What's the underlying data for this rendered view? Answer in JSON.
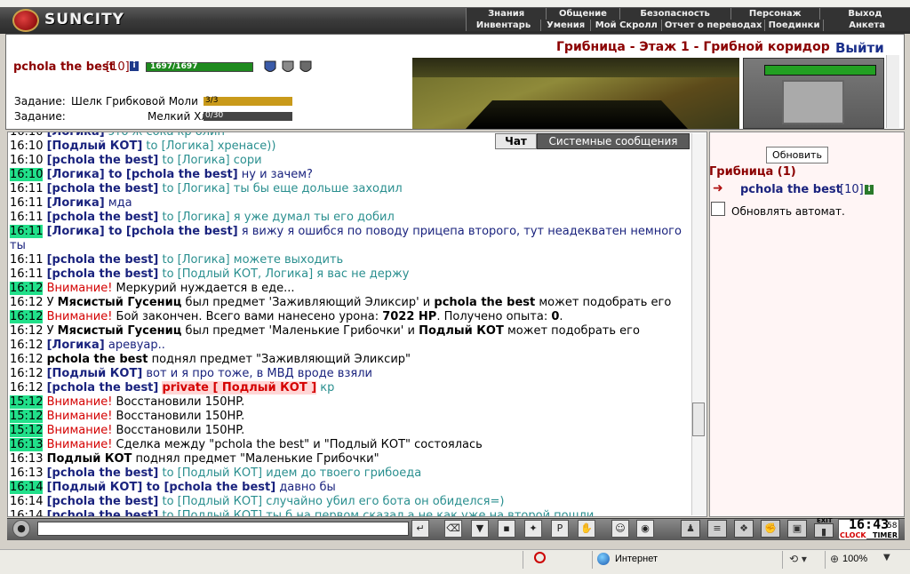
{
  "app": {
    "logo_text": "SUNCITY"
  },
  "menu": {
    "row1": [
      "Знания",
      "Общение",
      "Безопасность",
      "Персонаж",
      "Выход"
    ],
    "row2": [
      "Инвентарь",
      "Умения",
      "Мой Скролл",
      "Отчет о переводах",
      "Поединки",
      "Анкета"
    ]
  },
  "header": {
    "char_name": "pchola the best",
    "char_level": "[10]",
    "hp": "1697/1697",
    "hp_fraction": 1.0,
    "location": "Грибница - Этаж 1 - Грибной коридор",
    "exit_label": "Выйти",
    "quests": [
      {
        "label": "Задание:",
        "name": "Шелк Грибковой Моли",
        "progress": "3/3",
        "fraction": 1.0
      },
      {
        "label": "Задание:",
        "name": "Мелкий Хлюп",
        "progress": "0/30",
        "fraction": 0.0
      }
    ]
  },
  "chat": {
    "tabs": [
      "Чат",
      "Системные сообщения"
    ],
    "lines": [
      [
        "16:10 ",
        "t"
      ],
      [
        "16:10 ",
        "t"
      ],
      [
        "16:10 ",
        "t"
      ],
      [
        "16:10 ",
        "t"
      ]
    ],
    "messages": [
      {
        "time": "16:10",
        "hl": false,
        "segments": [
          [
            "[Логика]",
            "n"
          ],
          [
            " это ж сока кр олин",
            "msg"
          ]
        ]
      },
      {
        "time": "16:10",
        "hl": false,
        "segments": [
          [
            "[Подлый КОТ]",
            "n"
          ],
          [
            " to [Логика]",
            "to"
          ],
          [
            " хренасе))",
            "msg"
          ]
        ]
      },
      {
        "time": "16:10",
        "hl": false,
        "segments": [
          [
            "[pchola the best]",
            "n"
          ],
          [
            " to [Логика]",
            "to"
          ],
          [
            " сори",
            "msg"
          ]
        ]
      },
      {
        "time": "16:10",
        "hl": true,
        "segments": [
          [
            "[Логика]",
            "n"
          ],
          [
            " to [pchola the best]",
            "n"
          ],
          [
            " ну и зачем?",
            "msgp"
          ]
        ]
      },
      {
        "time": "16:11",
        "hl": false,
        "segments": [
          [
            "[pchola the best]",
            "n"
          ],
          [
            " to [Логика]",
            "to"
          ],
          [
            " ты бы еще дольше заходил",
            "msg"
          ]
        ]
      },
      {
        "time": "16:11",
        "hl": false,
        "segments": [
          [
            "[Логика]",
            "n"
          ],
          [
            " мда",
            "msgp"
          ]
        ]
      },
      {
        "time": "16:11",
        "hl": false,
        "segments": [
          [
            "[pchola the best]",
            "n"
          ],
          [
            " to [Логика]",
            "to"
          ],
          [
            " я уже думал ты его добил",
            "msg"
          ]
        ]
      },
      {
        "time": "16:11",
        "hl": true,
        "segments": [
          [
            "[Логика]",
            "n"
          ],
          [
            " to [pchola the best]",
            "n"
          ],
          [
            " я вижу я ошибся по поводу прицепа второго, тут неадекватен немного",
            "msgp"
          ]
        ]
      },
      {
        "time": "",
        "hl": false,
        "segments": [
          [
            "ты",
            "msgp"
          ]
        ]
      },
      {
        "time": "16:11",
        "hl": false,
        "segments": [
          [
            "[pchola the best]",
            "n"
          ],
          [
            " to [Логика]",
            "to"
          ],
          [
            " можете выходить",
            "msg"
          ]
        ]
      },
      {
        "time": "16:11",
        "hl": false,
        "segments": [
          [
            "[pchola the best]",
            "n"
          ],
          [
            " to [Подлый КОТ, Логика]",
            "to"
          ],
          [
            " я вас не держу",
            "msg"
          ]
        ]
      },
      {
        "time": "16:12",
        "hl": true,
        "segments": [
          [
            "Внимание!",
            "warn"
          ],
          [
            " Меркурий нуждается в еде...",
            "sys"
          ]
        ]
      },
      {
        "time": "16:12",
        "hl": false,
        "segments": [
          [
            "У ",
            "sys"
          ],
          [
            "Мясистый Гусениц",
            "b"
          ],
          [
            " был предмет 'Заживляющий Эликсир' и ",
            "sys"
          ],
          [
            "pchola the best",
            "b"
          ],
          [
            " может подобрать его",
            "sys"
          ]
        ]
      },
      {
        "time": "16:12",
        "hl": true,
        "segments": [
          [
            "Внимание!",
            "warn"
          ],
          [
            " Бой закончен. Всего вами нанесено урона: ",
            "sys"
          ],
          [
            "7022 HP",
            "b"
          ],
          [
            ". Получено опыта: ",
            "sys"
          ],
          [
            "0",
            "b"
          ],
          [
            ".",
            "sys"
          ]
        ]
      },
      {
        "time": "16:12",
        "hl": false,
        "segments": [
          [
            "У ",
            "sys"
          ],
          [
            "Мясистый Гусениц",
            "b"
          ],
          [
            " был предмет 'Маленькие Грибочки' и ",
            "sys"
          ],
          [
            "Подлый КОТ",
            "b"
          ],
          [
            " может подобрать его",
            "sys"
          ]
        ]
      },
      {
        "time": "16:12",
        "hl": false,
        "segments": [
          [
            "[Логика]",
            "n"
          ],
          [
            " аревуар..",
            "msgp"
          ]
        ]
      },
      {
        "time": "16:12",
        "hl": false,
        "segments": [
          [
            "pchola the best",
            "b"
          ],
          [
            " поднял предмет \"Заживляющий Эликсир\"",
            "sys"
          ]
        ]
      },
      {
        "time": "16:12",
        "hl": false,
        "segments": [
          [
            "[Подлый КОТ]",
            "n"
          ],
          [
            " вот и я про тоже, в МВД вроде взяли",
            "msgp"
          ]
        ]
      },
      {
        "time": "16:12",
        "hl": false,
        "segments": [
          [
            "[pchola the best]",
            "n"
          ],
          [
            " ",
            "sys"
          ],
          [
            "private [ Подлый КОТ ]",
            "priv"
          ],
          [
            " кр",
            "msg"
          ]
        ]
      },
      {
        "time": "15:12",
        "hl": true,
        "segments": [
          [
            "Внимание!",
            "warn"
          ],
          [
            " Восстановили 150HP.",
            "sys"
          ]
        ]
      },
      {
        "time": "15:12",
        "hl": true,
        "segments": [
          [
            "Внимание!",
            "warn"
          ],
          [
            " Восстановили 150HP.",
            "sys"
          ]
        ]
      },
      {
        "time": "15:12",
        "hl": true,
        "segments": [
          [
            "Внимание!",
            "warn"
          ],
          [
            " Восстановили 150HP.",
            "sys"
          ]
        ]
      },
      {
        "time": "16:13",
        "hl": true,
        "segments": [
          [
            "Внимание!",
            "warn"
          ],
          [
            " Сделка между \"pchola the best\" и \"Подлый КОТ\" состоялась",
            "sys"
          ]
        ]
      },
      {
        "time": "16:13",
        "hl": false,
        "segments": [
          [
            "Подлый КОТ",
            "b"
          ],
          [
            " поднял предмет \"Маленькие Грибочки\"",
            "sys"
          ]
        ]
      },
      {
        "time": "16:13",
        "hl": false,
        "segments": [
          [
            "[pchola the best]",
            "n"
          ],
          [
            " to [Подлый КОТ]",
            "to"
          ],
          [
            " идем до твоего грибоеда",
            "msg"
          ]
        ]
      },
      {
        "time": "16:14",
        "hl": true,
        "segments": [
          [
            "[Подлый КОТ]",
            "n"
          ],
          [
            " to [pchola the best]",
            "n"
          ],
          [
            " давно бы",
            "msgp"
          ]
        ]
      },
      {
        "time": "16:14",
        "hl": false,
        "segments": [
          [
            "[pchola the best]",
            "n"
          ],
          [
            " to [Подлый КОТ]",
            "to"
          ],
          [
            " случайно убил его бота он обиделся=)",
            "msg"
          ]
        ]
      },
      {
        "time": "16:14",
        "hl": false,
        "segments": [
          [
            "[pchola the best]",
            "n"
          ],
          [
            " to [Подлый КОТ]",
            "to"
          ],
          [
            " ты б на первом сказал а не как уже на второй пошли",
            "msg"
          ]
        ]
      }
    ]
  },
  "side": {
    "refresh_label": "Обновить",
    "room_title": "Грибница (1)",
    "player_name": "pchola the best",
    "player_level": "[10]",
    "auto_refresh_label": "Обновлять автомат."
  },
  "toolbar": {
    "clock_time": "16:43",
    "clock_sec": "58",
    "clock_label": "CLOCK",
    "timer_label": "TIMER",
    "exit_label": "EXIT"
  },
  "status": {
    "zone": "Интернет",
    "zoom": "100%"
  },
  "colors": {
    "accent_dark_red": "#8b0000",
    "name_blue": "#1a237e",
    "highlight_green": "#21e08a",
    "warning_red": "#d40000",
    "teal": "#2a8f8f"
  }
}
